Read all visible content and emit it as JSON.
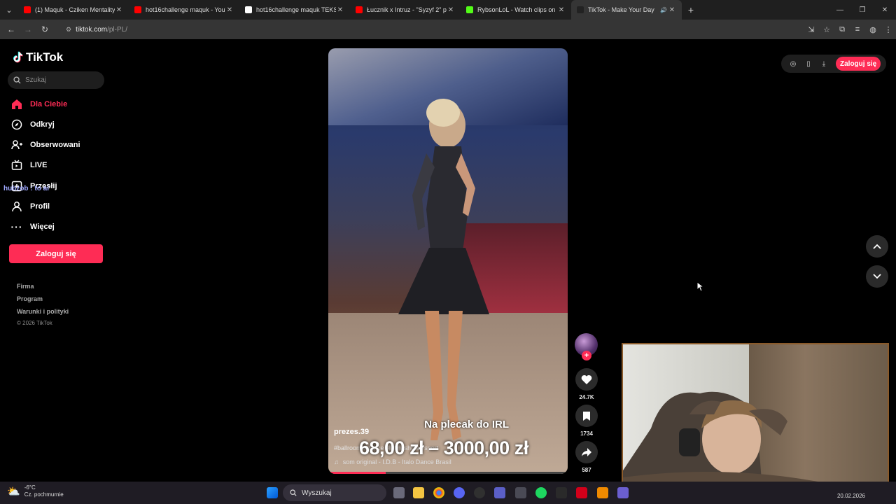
{
  "browser": {
    "tabs": [
      {
        "title": "(1) Maquk - Cziken Mentality | F",
        "fav_color": "#ff0000",
        "active": false
      },
      {
        "title": "hot16challenge maquk - YouTu",
        "fav_color": "#ff0000",
        "active": false
      },
      {
        "title": "hot16challenge maquk TEKSTO",
        "fav_color": "#ffffff",
        "active": false
      },
      {
        "title": "Łucznik x Intruz - \"Syzyf 2\" proc",
        "fav_color": "#ff0000",
        "active": false
      },
      {
        "title": "RybsonLoL - Watch clips on Kic",
        "fav_color": "#53fc18",
        "active": false
      },
      {
        "title": "TikTok - Make Your Day",
        "fav_color": "#222222",
        "active": true
      }
    ],
    "url_host": "tiktok.com",
    "url_path": "/pl-PL/"
  },
  "sidebar": {
    "logo_text": "TikTok",
    "search_placeholder": "Szukaj",
    "nav": [
      {
        "label": "Dla Ciebie",
        "icon": "home-icon",
        "active": true
      },
      {
        "label": "Odkryj",
        "icon": "compass-icon",
        "active": false
      },
      {
        "label": "Obserwowani",
        "icon": "following-icon",
        "active": false
      },
      {
        "label": "LIVE",
        "icon": "live-icon",
        "active": false
      },
      {
        "label": "Przesłij",
        "icon": "upload-icon",
        "active": false
      },
      {
        "label": "Profil",
        "icon": "profile-icon",
        "active": false
      },
      {
        "label": "Więcej",
        "icon": "more-icon",
        "active": false
      }
    ],
    "overlay_text": "hubzob : to ai",
    "login_label": "Zaloguj się",
    "footer": [
      "Firma",
      "Program",
      "Warunki i polityki"
    ],
    "copyright": "© 2026 TikTok"
  },
  "video": {
    "author": "prezes.39",
    "caption": "Na plecak do IRL",
    "price_overlay": "68,00 zł – 3000,00 zł",
    "tags": "#ballroom #dance #latinashow #sport",
    "music": "som original - I.D.B - Italo Dance Brasil",
    "progress_fraction": 0.24
  },
  "actions": {
    "likes": "24.7K",
    "saves": "1734",
    "shares": "587"
  },
  "top_controls": {
    "login_label": "Zaloguj się"
  },
  "taskbar": {
    "temperature": "-6°C",
    "weather_desc": "Cz. pochmurnie",
    "search_label": "Wyszukaj",
    "date": "20.02.2026"
  }
}
